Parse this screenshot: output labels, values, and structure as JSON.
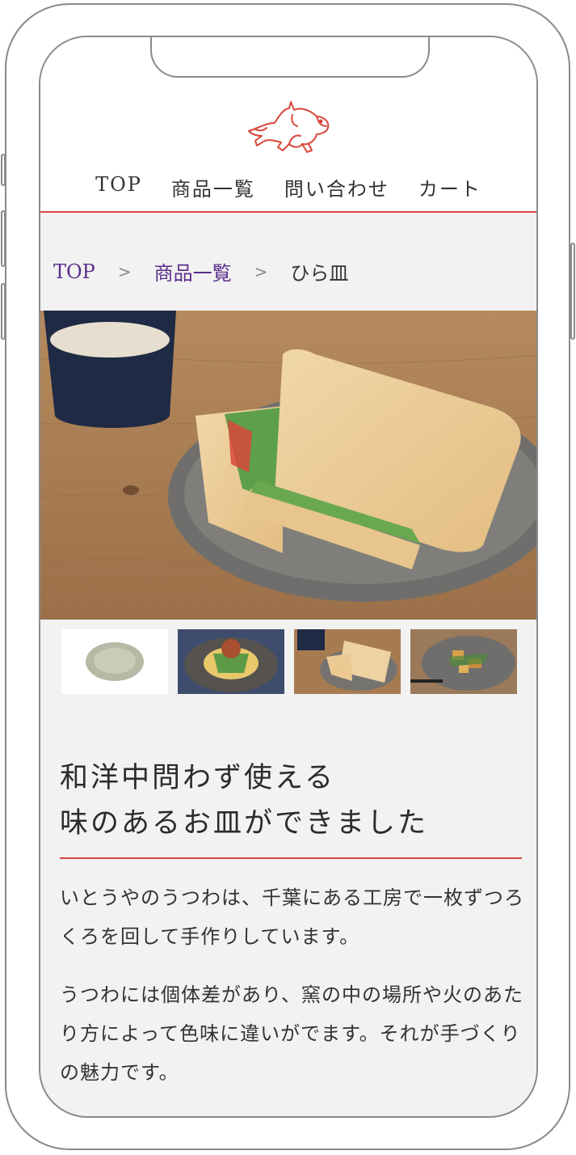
{
  "nav": {
    "items": [
      "TOP",
      "商品一覧",
      "問い合わせ",
      "カート"
    ]
  },
  "breadcrumb": {
    "home": "TOP",
    "list": "商品一覧",
    "current": "ひら皿",
    "separator": ">"
  },
  "product": {
    "heading_line1": "和洋中問わず使える",
    "heading_line2": "味のあるお皿ができました",
    "paragraph1": "いとうやのうつわは、千葉にある工房で一枚ずつろくろを回して手作りしています。",
    "paragraph2": "うつわには個体差があり、窯の中の場所や火のあたり方によって色味に違いがでます。それが手づくりの魅力です。"
  },
  "icons": {
    "logo": "dog-logo-icon"
  },
  "colors": {
    "accent": "#d9473b",
    "link": "#5b2e8c",
    "background": "#f2f2f2"
  }
}
